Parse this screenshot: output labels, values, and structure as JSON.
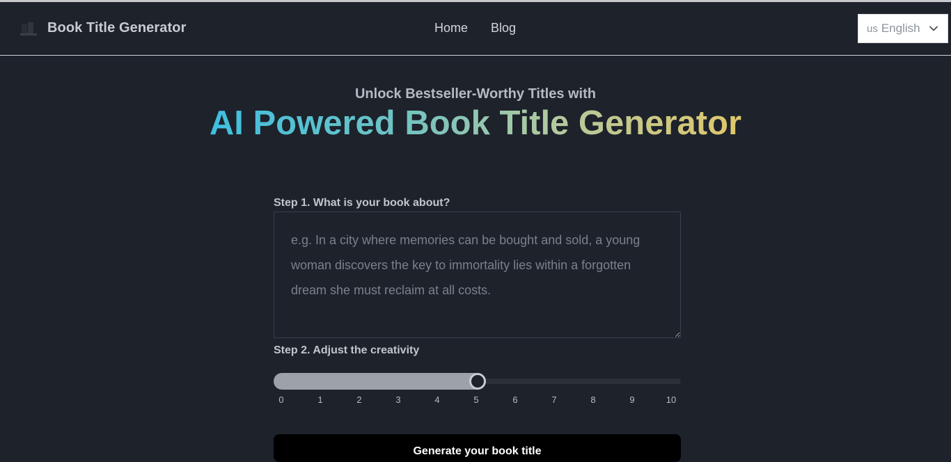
{
  "header": {
    "brand_title": "Book Title Generator",
    "nav": [
      {
        "label": "Home"
      },
      {
        "label": "Blog"
      }
    ],
    "language": {
      "flag": "us",
      "label": "English"
    }
  },
  "hero": {
    "subtitle": "Unlock Bestseller-Worthy Titles with",
    "headline": "AI Powered Book Title Generator"
  },
  "form": {
    "step1_label": "Step 1. What is your book about?",
    "description_placeholder": "e.g. In a city where memories can be bought and sold, a young woman discovers the key to immortality lies within a forgotten dream she must reclaim at all costs.",
    "description_value": "",
    "step2_label": "Step 2. Adjust the creativity",
    "creativity": {
      "min": 0,
      "max": 10,
      "value": 5,
      "ticks": [
        "0",
        "1",
        "2",
        "3",
        "4",
        "5",
        "6",
        "7",
        "8",
        "9",
        "10"
      ]
    },
    "generate_label": "Generate your book title"
  },
  "colors": {
    "background": "#1d222b",
    "gradient_start": "#3fbfe0",
    "gradient_end": "#e0c76a",
    "button": "#000000"
  }
}
